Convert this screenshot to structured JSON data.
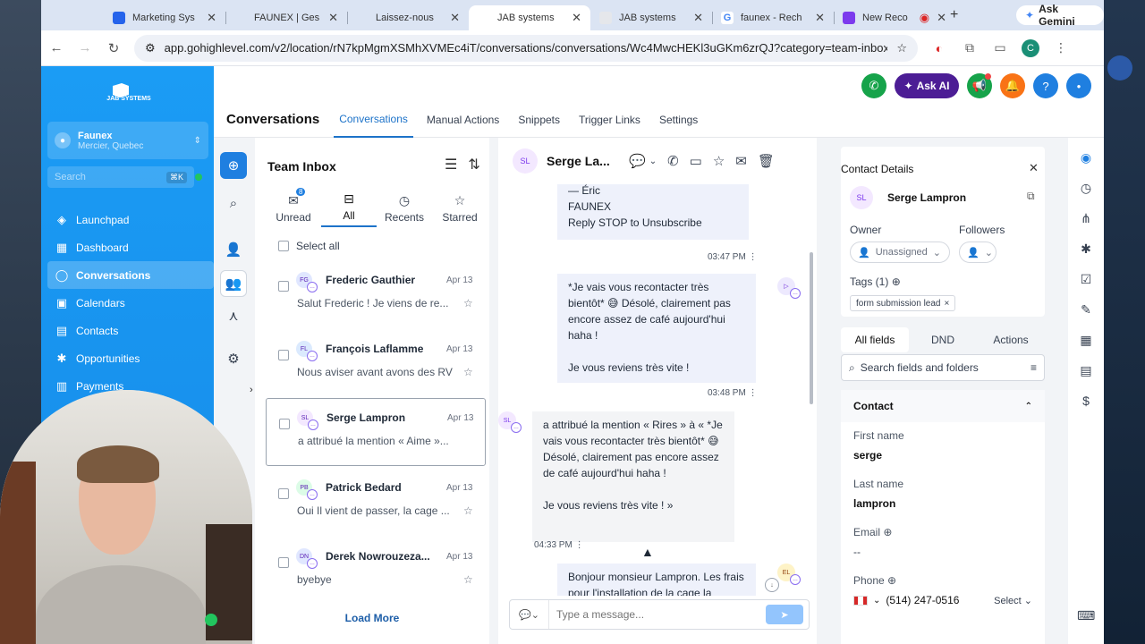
{
  "browser": {
    "tabs": [
      {
        "label": "Marketing Sys",
        "color": "#2563eb",
        "active": false
      },
      {
        "label": "FAUNEX | Ges",
        "color": "#e5e7eb",
        "active": false
      },
      {
        "label": "Laissez-nous",
        "color": "#e5e7eb",
        "active": false
      },
      {
        "label": "JAB systems",
        "color": "#e5e7eb",
        "active": true
      },
      {
        "label": "JAB systems",
        "color": "#e5e7eb",
        "active": false
      },
      {
        "label": "faunex - Rech",
        "color": "#4285f4",
        "active": false
      },
      {
        "label": "New Reco",
        "color": "#7c3aed",
        "active": false
      }
    ],
    "new_tab": "+",
    "gemini_label": "Ask Gemini",
    "url": "app.gohighlevel.com/v2/location/rN7kpMgmXSMhXVMEc4iT/conversations/conversations/Wc4MwcHEKl3uGKm6zrQJ?category=team-inbox&...",
    "profile_initial": "C"
  },
  "sidebar": {
    "logo_text": "JAB SYSTEMS",
    "location_name": "Faunex",
    "location_sub": "Mercier, Quebec",
    "search_placeholder": "Search",
    "search_kbd": "⌘K",
    "items": [
      {
        "label": "Launchpad",
        "icon": "rocket-icon",
        "glyph": "◈",
        "active": false
      },
      {
        "label": "Dashboard",
        "icon": "dashboard-icon",
        "glyph": "▦",
        "active": false
      },
      {
        "label": "Conversations",
        "icon": "chat-icon",
        "glyph": "◯",
        "active": true
      },
      {
        "label": "Calendars",
        "icon": "calendar-icon",
        "glyph": "▣",
        "active": false
      },
      {
        "label": "Contacts",
        "icon": "contacts-icon",
        "glyph": "▤",
        "active": false
      },
      {
        "label": "Opportunities",
        "icon": "opportunities-icon",
        "glyph": "✱",
        "active": false
      },
      {
        "label": "Payments",
        "icon": "payments-icon",
        "glyph": "▥",
        "active": false
      }
    ]
  },
  "header": {
    "title": "Conversations",
    "tabs": [
      "Conversations",
      "Manual Actions",
      "Snippets",
      "Trigger Links",
      "Settings"
    ],
    "active_tab": "Conversations",
    "ask_ai": "Ask AI",
    "icon_colors": {
      "phone": "#16a34a",
      "ai": "#4c1d95",
      "megaphone": "#16a34a",
      "bell": "#f97316",
      "help": "#1f7fe0",
      "avatar": "#1f7fe0"
    }
  },
  "inbox": {
    "title": "Team Inbox",
    "filters": [
      {
        "label": "Unread",
        "badge": "8"
      },
      {
        "label": "All",
        "badge": ""
      },
      {
        "label": "Recents",
        "badge": ""
      },
      {
        "label": "Starred",
        "badge": ""
      }
    ],
    "active_filter": "All",
    "select_all": "Select all",
    "conversations": [
      {
        "initials": "FG",
        "name": "Frederic Gauthier",
        "date": "Apr 13",
        "preview": "Salut Frederic ! Je viens de re...",
        "avatar_color": "#e0e7ff"
      },
      {
        "initials": "FL",
        "name": "François Laflamme",
        "date": "Apr 13",
        "preview": "Nous aviser avant avons des RV",
        "avatar_color": "#dbeafe"
      },
      {
        "initials": "SL",
        "name": "Serge Lampron",
        "date": "Apr 13",
        "preview": "a attribué la mention « Aime »...",
        "avatar_color": "#f3e8ff"
      },
      {
        "initials": "PB",
        "name": "Patrick Bedard",
        "date": "Apr 13",
        "preview": "Oui Il vient de passer, la cage ...",
        "avatar_color": "#dcfce7"
      },
      {
        "initials": "DN",
        "name": "Derek Nowrouzeza...",
        "date": "Apr 13",
        "preview": "byebye",
        "avatar_color": "#e0e7ff"
      }
    ],
    "load_more": "Load More"
  },
  "chat": {
    "contact_initials": "SL",
    "contact_name": "Serge La...",
    "messages": [
      {
        "text": "— Éric\nFAUNEX\nReply STOP to Unsubscribe",
        "time": "03:47 PM",
        "direction": "out"
      },
      {
        "text": "*Je vais vous recontacter très bientôt* 😅 Désolé, clairement pas encore assez de café aujourd'hui haha !\n\nJe vous reviens très vite !",
        "time": "03:48 PM",
        "direction": "out"
      },
      {
        "text": "a attribué la mention « Rires » à « *Je vais vous recontacter très bientôt* 😅 Désolé, clairement pas encore assez de café aujourd'hui haha !\n\nJe vous reviens très vite ! »",
        "time": "04:33 PM",
        "direction": "in",
        "initials": "SL"
      },
      {
        "text": "Bonjour monsieur Lampron. Les frais pour l'installation de la cage la",
        "time": "",
        "direction": "out",
        "initials": "EL"
      }
    ],
    "composer_placeholder": "Type a message..."
  },
  "contact": {
    "title": "Contact Details",
    "initials": "SL",
    "name": "Serge Lampron",
    "owner_label": "Owner",
    "owner_value": "Unassigned",
    "followers_label": "Followers",
    "tags_label": "Tags (1)",
    "tag": "form submission lead",
    "field_tabs": [
      "All fields",
      "DND",
      "Actions"
    ],
    "active_field_tab": "All fields",
    "search_placeholder": "Search fields and folders",
    "section": "Contact",
    "fields": [
      {
        "label": "First name",
        "value": "serge"
      },
      {
        "label": "Last name",
        "value": "lampron"
      },
      {
        "label": "Email",
        "value": "--"
      },
      {
        "label": "Phone",
        "value": "(514) 247-0516"
      }
    ],
    "phone_select": "Select"
  }
}
